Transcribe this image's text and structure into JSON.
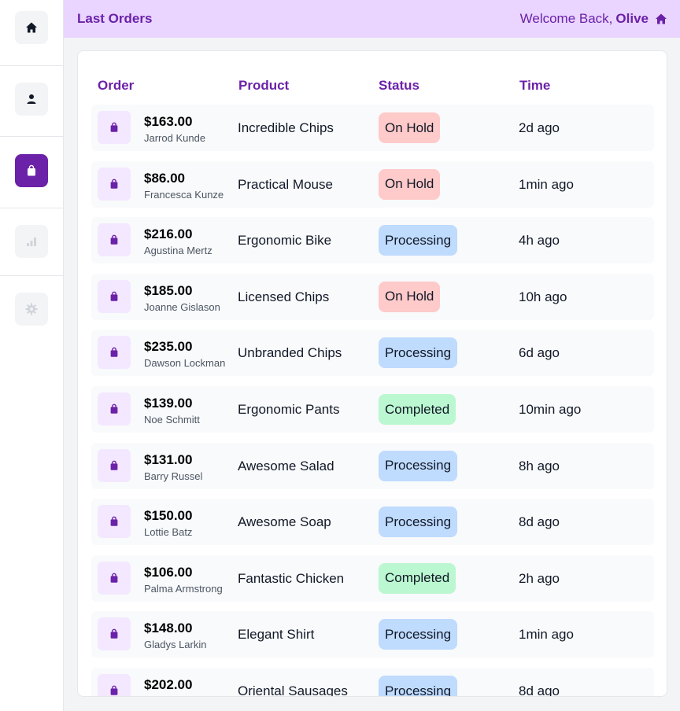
{
  "header": {
    "title": "Last Orders",
    "welcome_prefix": "Welcome Back,",
    "user_name": "Olive"
  },
  "sidebar": {
    "items": [
      {
        "name": "home",
        "icon": "home-icon",
        "active": false
      },
      {
        "name": "profile",
        "icon": "user-icon",
        "active": false
      },
      {
        "name": "orders",
        "icon": "shopping-bag-icon",
        "active": true
      },
      {
        "name": "stats",
        "icon": "bar-chart-icon",
        "active": false
      },
      {
        "name": "settings",
        "icon": "gear-icon",
        "active": false
      }
    ]
  },
  "table": {
    "columns": [
      "Order",
      "Product",
      "Status",
      "Time"
    ],
    "rows": [
      {
        "amount": "$163.00",
        "customer": "Jarrod Kunde",
        "product": "Incredible Chips",
        "status": "On Hold",
        "time": "2d ago"
      },
      {
        "amount": "$86.00",
        "customer": "Francesca Kunze",
        "product": "Practical Mouse",
        "status": "On Hold",
        "time": "1min ago"
      },
      {
        "amount": "$216.00",
        "customer": "Agustina Mertz",
        "product": "Ergonomic Bike",
        "status": "Processing",
        "time": "4h ago"
      },
      {
        "amount": "$185.00",
        "customer": "Joanne Gislason",
        "product": "Licensed Chips",
        "status": "On Hold",
        "time": "10h ago"
      },
      {
        "amount": "$235.00",
        "customer": "Dawson Lockman",
        "product": "Unbranded Chips",
        "status": "Processing",
        "time": "6d ago"
      },
      {
        "amount": "$139.00",
        "customer": "Noe Schmitt",
        "product": "Ergonomic Pants",
        "status": "Completed",
        "time": "10min ago"
      },
      {
        "amount": "$131.00",
        "customer": "Barry Russel",
        "product": "Awesome Salad",
        "status": "Processing",
        "time": "8h ago"
      },
      {
        "amount": "$150.00",
        "customer": "Lottie Batz",
        "product": "Awesome Soap",
        "status": "Processing",
        "time": "8d ago"
      },
      {
        "amount": "$106.00",
        "customer": "Palma Armstrong",
        "product": "Fantastic Chicken",
        "status": "Completed",
        "time": "2h ago"
      },
      {
        "amount": "$148.00",
        "customer": "Gladys Larkin",
        "product": "Elegant Shirt",
        "status": "Processing",
        "time": "1min ago"
      },
      {
        "amount": "$202.00",
        "customer": "",
        "product": "Oriental Sausages",
        "status": "Processing",
        "time": "8d ago"
      }
    ]
  },
  "colors": {
    "brand": "#6b21a8",
    "header_bg": "#e9d5ff",
    "on_hold": "#fecaca",
    "processing": "#bfdbfe",
    "completed": "#bbf7d0"
  }
}
